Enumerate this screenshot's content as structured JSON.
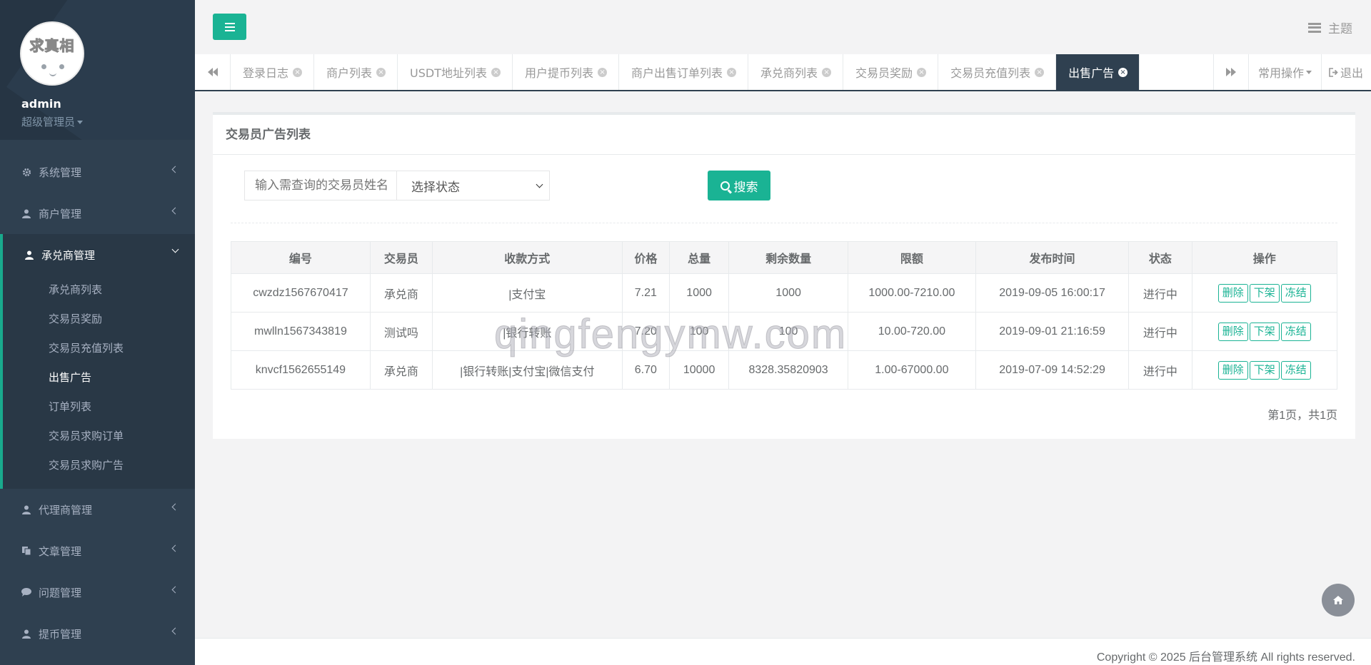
{
  "sidebar": {
    "avatar_text": "求真相",
    "admin_name": "admin",
    "admin_role": "超级管理员",
    "menu": [
      {
        "label": "系统管理",
        "icon": "gear-icon"
      },
      {
        "label": "商户管理",
        "icon": "user-icon"
      },
      {
        "label": "承兑商管理",
        "icon": "user-icon"
      },
      {
        "label": "代理商管理",
        "icon": "user-icon"
      },
      {
        "label": "文章管理",
        "icon": "copy-icon"
      },
      {
        "label": "问题管理",
        "icon": "comment-icon"
      },
      {
        "label": "提币管理",
        "icon": "user-icon"
      }
    ],
    "submenu": [
      "承兑商列表",
      "交易员奖励",
      "交易员充值列表",
      "出售广告",
      "订单列表",
      "交易员求购订单",
      "交易员求购广告"
    ]
  },
  "topbar": {
    "theme_label": "主题"
  },
  "tabs": {
    "items": [
      "登录日志",
      "商户列表",
      "USDT地址列表",
      "用户提币列表",
      "商户出售订单列表",
      "承兑商列表",
      "交易员奖励",
      "交易员充值列表",
      "出售广告"
    ],
    "common_ops": "常用操作",
    "exit": "退出"
  },
  "panel": {
    "title": "交易员广告列表",
    "search_placeholder": "输入需查询的交易员姓名",
    "status_select": "选择状态",
    "search_button": "搜索",
    "columns": [
      "编号",
      "交易员",
      "收款方式",
      "价格",
      "总量",
      "剩余数量",
      "限额",
      "发布时间",
      "状态",
      "操作"
    ],
    "rows": [
      {
        "id": "cwzdz1567670417",
        "trader": "承兑商",
        "payment": "|支付宝",
        "price": "7.21",
        "total": "1000",
        "remaining": "1000",
        "limit": "1000.00-7210.00",
        "time": "2019-09-05 16:00:17",
        "status": "进行中"
      },
      {
        "id": "mwlln1567343819",
        "trader": "测试吗",
        "payment": "|银行转账",
        "price": "7.20",
        "total": "100",
        "remaining": "100",
        "limit": "10.00-720.00",
        "time": "2019-09-01 21:16:59",
        "status": "进行中"
      },
      {
        "id": "knvcf1562655149",
        "trader": "承兑商",
        "payment": "|银行转账|支付宝|微信支付",
        "price": "6.70",
        "total": "10000",
        "remaining": "8328.35820903",
        "limit": "1.00-67000.00",
        "time": "2019-07-09 14:52:29",
        "status": "进行中"
      }
    ],
    "actions": {
      "delete": "删除",
      "offshelf": "下架",
      "freeze": "冻结"
    },
    "pagination": "第1页，共1页"
  },
  "watermark": "qingfengymw.com",
  "footer": "Copyright © 2025 后台管理系统 All rights reserved.",
  "colors": {
    "sidebar": "#2f4050",
    "accent": "#1ab394",
    "tab_active": "#2f4050"
  }
}
